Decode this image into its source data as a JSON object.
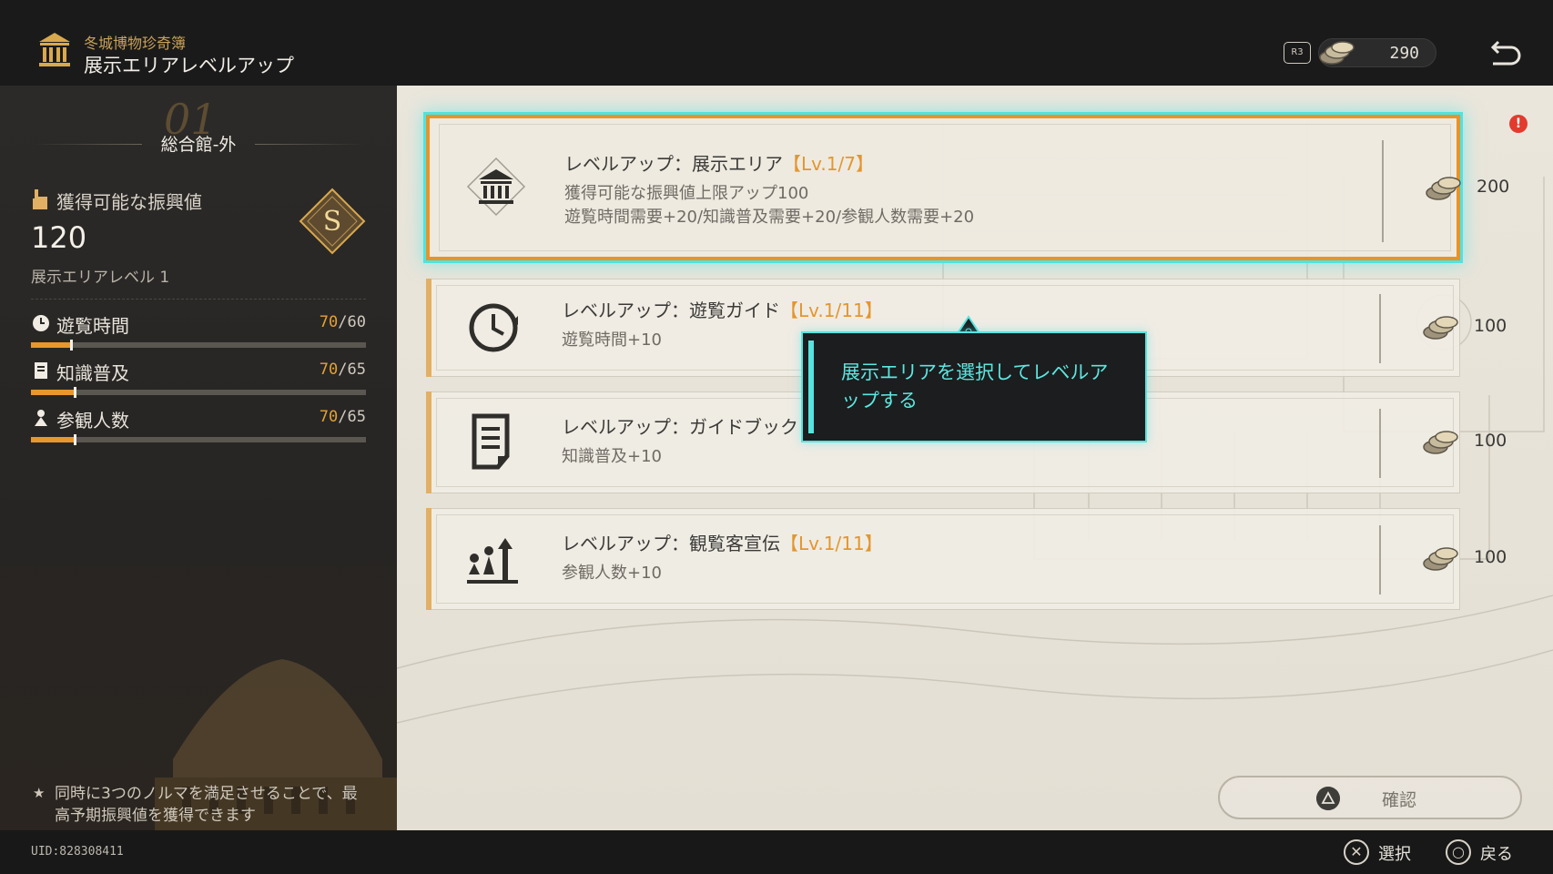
{
  "header": {
    "subtitle": "冬城博物珍奇簿",
    "title": "展示エリアレベルアップ",
    "r3_label": "R3",
    "currency_value": "290",
    "icons": [
      "museum-icon",
      "coin-icon",
      "back-arrow-icon"
    ]
  },
  "left_panel": {
    "area_number": "01",
    "area_name": "総合館-外",
    "gain_label": "獲得可能な振興値",
    "gain_value": "120",
    "rank": "S",
    "area_level_label": "展示エリアレベル 1",
    "stats": [
      {
        "label": "遊覧時間",
        "current": "70",
        "separator": "/",
        "max": "60",
        "fill_fraction": 0.12,
        "icon": "clock-icon"
      },
      {
        "label": "知識普及",
        "current": "70",
        "separator": "/",
        "max": "65",
        "fill_fraction": 0.13,
        "icon": "book-icon"
      },
      {
        "label": "参観人数",
        "current": "70",
        "separator": "/",
        "max": "65",
        "fill_fraction": 0.13,
        "icon": "person-icon"
      }
    ],
    "hint_star": "★",
    "hint_text": "同時に3つのノルマを満足させることで、最高予期振興値を獲得できます"
  },
  "cards": [
    {
      "title_prefix": "レベルアップ：展示エリア",
      "level": "【Lv.1/7】",
      "desc_lines": [
        "獲得可能な振興値上限アップ100",
        "遊覧時間需要+20/知識普及需要+20/参観人数需要+20"
      ],
      "cost": "200",
      "icon": "museum-icon",
      "selected": true,
      "notice": "!"
    },
    {
      "title_prefix": "レベルアップ：遊覧ガイド",
      "level": "【Lv.1/11】",
      "desc_lines": [
        "遊覧時間+10"
      ],
      "cost": "100",
      "icon": "clock-icon",
      "selected": false
    },
    {
      "title_prefix": "レベルアップ：ガイドブック",
      "level": "",
      "desc_lines": [
        "知識普及+10"
      ],
      "cost": "100",
      "icon": "document-icon",
      "selected": false
    },
    {
      "title_prefix": "レベルアップ：観覧客宣伝",
      "level": "【Lv.1/11】",
      "desc_lines": [
        "参観人数+10"
      ],
      "cost": "100",
      "icon": "audience-growth-icon",
      "selected": false
    }
  ],
  "tooltip": {
    "text": "展示エリアを選択してレベルアップする"
  },
  "confirm_button": {
    "label": "確認",
    "icon": "triangle-button-icon"
  },
  "bottom_bar": {
    "uid": "UID:828308411",
    "select_label": "選択",
    "select_glyph": "✕",
    "back_label": "戻る",
    "back_glyph": "○"
  },
  "colors": {
    "accent_orange": "#e8932a",
    "highlight_cyan": "#56e4df",
    "gold": "#c9a25a",
    "notice_red": "#e23b2e"
  }
}
